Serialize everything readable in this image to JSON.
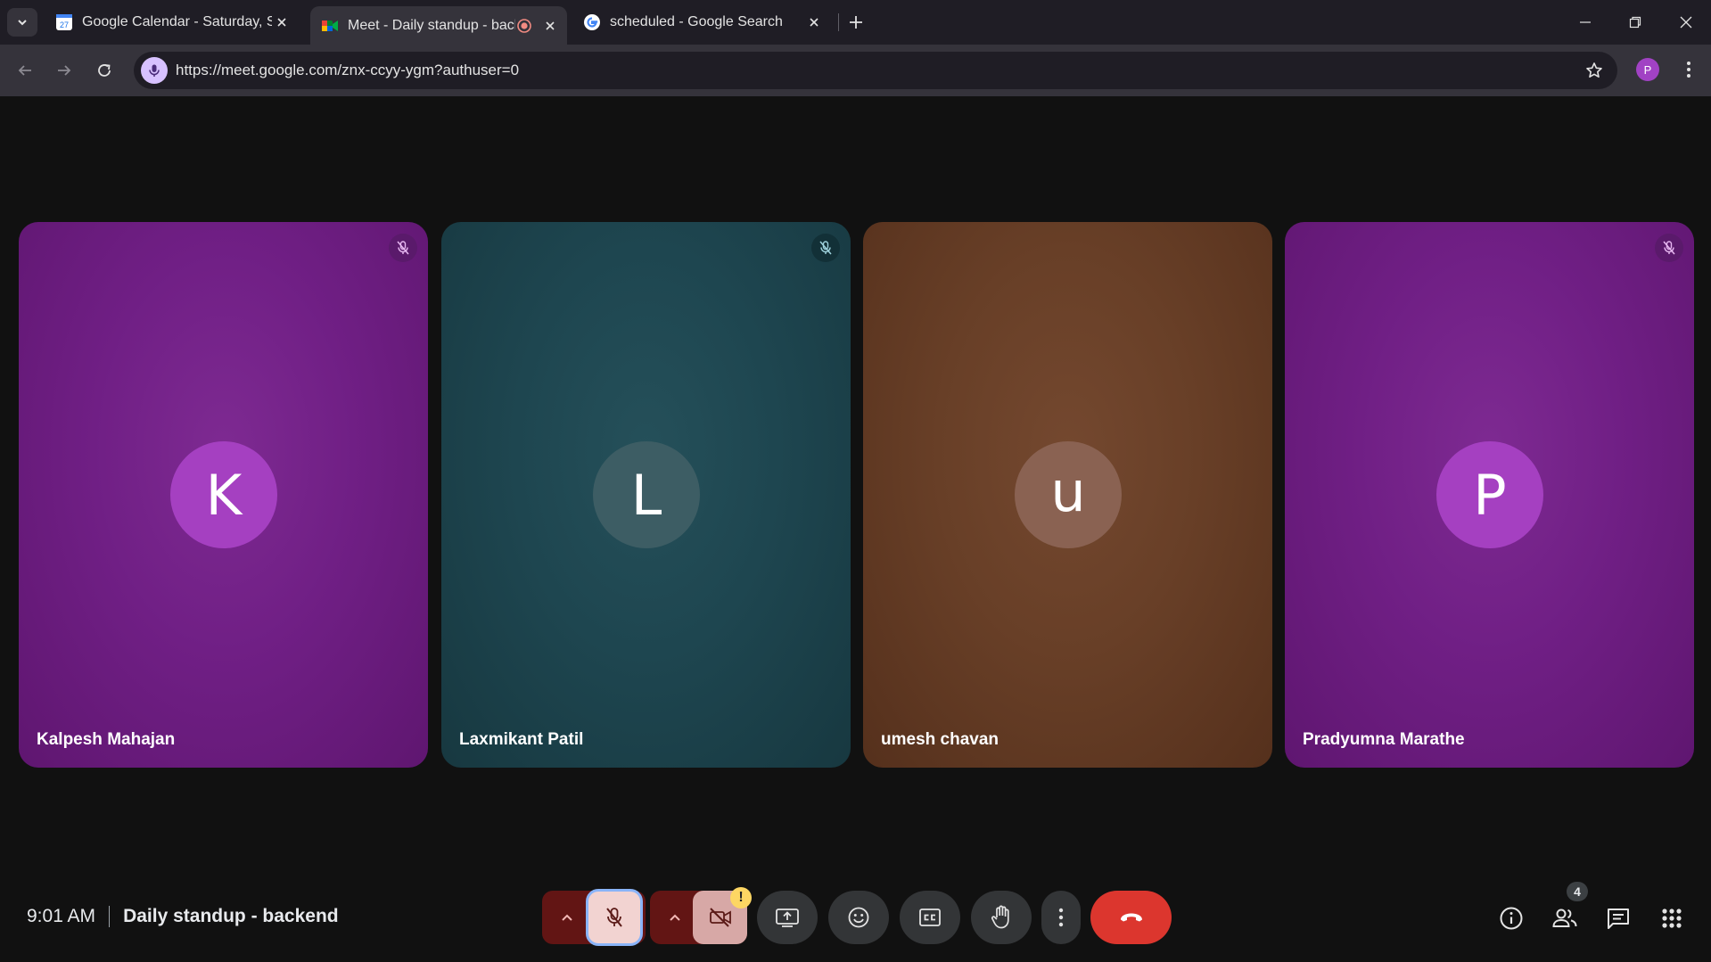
{
  "browser": {
    "tabs": [
      {
        "title": "Google Calendar - Saturday, Se",
        "favicon": "calendar-icon",
        "active": false
      },
      {
        "title": "Meet - Daily standup - back",
        "favicon": "meet-icon",
        "active": true,
        "recording": true
      },
      {
        "title": "scheduled - Google Search",
        "favicon": "google-icon",
        "active": false
      }
    ],
    "url": "https://meet.google.com/znx-ccyy-ygm?authuser=0",
    "profile_initial": "P",
    "calendar_favicon_day": "27"
  },
  "participants": [
    {
      "name": "Kalpesh Mahajan",
      "initial": "K",
      "color": "purple",
      "muted": true
    },
    {
      "name": "Laxmikant Patil",
      "initial": "L",
      "color": "teal",
      "muted": true
    },
    {
      "name": "umesh chavan",
      "initial": "u",
      "color": "brown",
      "muted": false
    },
    {
      "name": "Pradyumna Marathe",
      "initial": "P",
      "color": "purple",
      "muted": true
    }
  ],
  "meeting": {
    "time": "9:01 AM",
    "title": "Daily standup - backend"
  },
  "controls": {
    "mic": "muted",
    "camera": "off",
    "camera_warning": "!",
    "people_count": "4"
  },
  "colors": {
    "tab_bar": "#1f1d25",
    "toolbar": "#35333b",
    "stage": "#111111",
    "leave_red": "#dc362e",
    "focus_ring": "#8ab4f8"
  }
}
